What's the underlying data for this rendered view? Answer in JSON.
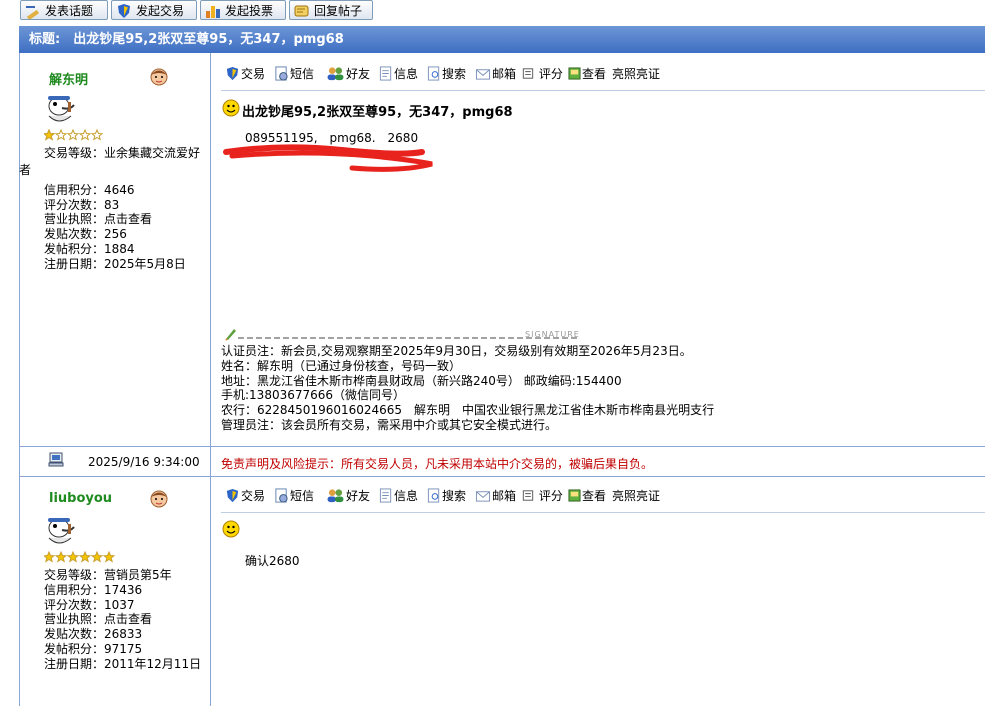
{
  "toolbar": {
    "new_topic": "发表话题",
    "new_trade": "发起交易",
    "new_poll": "发起投票",
    "reply": "回复帖子"
  },
  "thread": {
    "title": "标题:　出龙钞尾95,2张双至尊95，无347，pmg68"
  },
  "edge_char": "者",
  "action_labels": {
    "trade": "交易",
    "sms": "短信",
    "friend": "好友",
    "info": "信息",
    "search": "搜索",
    "mail": "邮箱",
    "rate": "评分",
    "view": "查看",
    "license": "亮照亮证"
  },
  "posts": [
    {
      "author": "解东明",
      "info": [
        "交易等级：业余集藏交流爱好",
        "",
        "信用积分：4646",
        "评分次数：83",
        "营业执照：点击查看",
        "发贴次数：256",
        "发帖积分：1884",
        "注册日期：2025年5月8日"
      ],
      "post_title": "出龙钞尾95,2张双至尊95，无347，pmg68",
      "content": "089551195,　pmg68.　2680",
      "signature_mark": "SIGNATURE",
      "signature": [
        "认证员注：新会员,交易观察期至2025年9月30日，交易级别有效期至2026年5月23日。",
        "姓名：解东明（已通过身份核查，号码一致）",
        "地址：黑龙江省佳木斯市桦南县财政局（新兴路240号） 邮政编码:154400",
        "手机:13803677666（微信同号）",
        "农行：6228450196016024665　解东明　中国农业银行黑龙江省佳木斯市桦南县光明支行",
        "管理员注：该会员所有交易，需采用中介或其它安全模式进行。"
      ],
      "timestamp": "2025/9/16 9:34:00",
      "disclaimer": "免责声明及风险提示：所有交易人员，凡未采用本站中介交易的，被骗后果自负。"
    },
    {
      "author": "liuboyou",
      "info": [
        "交易等级：营销员第5年",
        "信用积分：17436",
        "评分次数：1037",
        "营业执照：点击查看",
        "发贴次数：26833",
        "发帖积分：97175",
        "注册日期：2011年12月11日"
      ],
      "content": "确认2680"
    }
  ],
  "colors": {
    "title_bar": "#4a7acb",
    "username": "#1f8a1f",
    "disclaimer": "#c00000",
    "grid": "#8aa6d6"
  }
}
